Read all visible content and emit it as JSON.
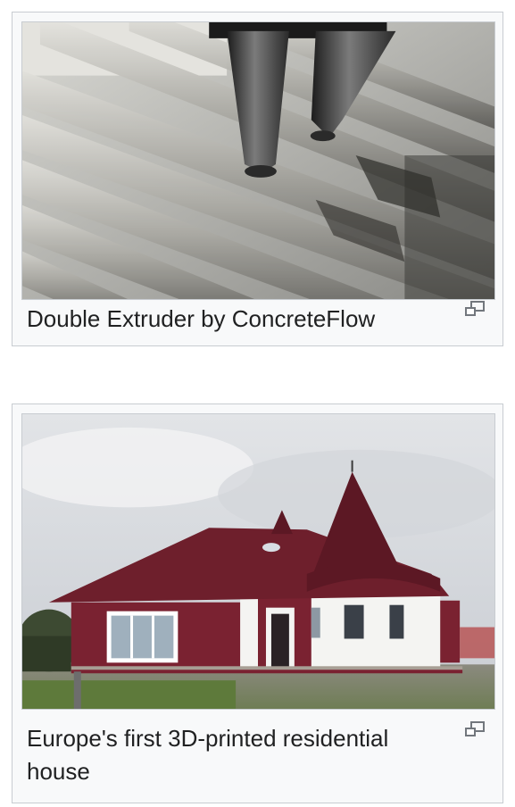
{
  "figures": [
    {
      "caption": "Double Extruder by ConcreteFlow",
      "image_subject": "concrete-extruder-photo",
      "magnify_icon": "enlarge-icon"
    },
    {
      "caption": "Europe's first 3D-printed residential house",
      "image_subject": "3d-printed-house-photo",
      "magnify_icon": "enlarge-icon"
    }
  ],
  "colors": {
    "frame_background": "#f8f9fa",
    "frame_border": "#c8ccd1",
    "caption_text": "#202122",
    "house_roof": "#6e1f2c",
    "house_wall": "#7a2231"
  }
}
